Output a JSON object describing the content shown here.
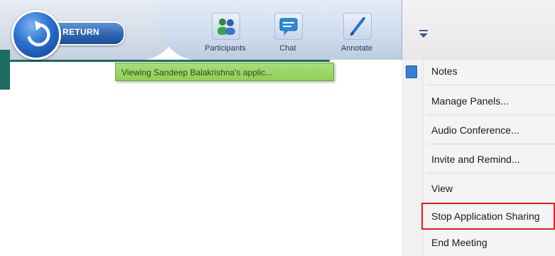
{
  "toolbar": {
    "return_label": "RETURN",
    "items": [
      {
        "label": "Participants",
        "icon": "participants-icon"
      },
      {
        "label": "Chat",
        "icon": "chat-icon"
      },
      {
        "label": "Annotate",
        "icon": "annotate-icon"
      }
    ],
    "menu_toggle_icon": "chevron-down-icon"
  },
  "tooltip": {
    "text": "Viewing Sandeep Balakrishna's applic..."
  },
  "menu": {
    "items": [
      {
        "label": "Notes"
      },
      {
        "label": "Manage Panels..."
      },
      {
        "label": "Audio Conference..."
      },
      {
        "label": "Invite and Remind..."
      },
      {
        "label": "View"
      },
      {
        "label": "Stop Application Sharing"
      },
      {
        "label": "End Meeting"
      }
    ],
    "highlight_color": "#d8232a"
  },
  "colors": {
    "accent_blue": "#2a6fd0",
    "teal": "#1d6b63",
    "tooltip_green": "#8fcf56"
  }
}
